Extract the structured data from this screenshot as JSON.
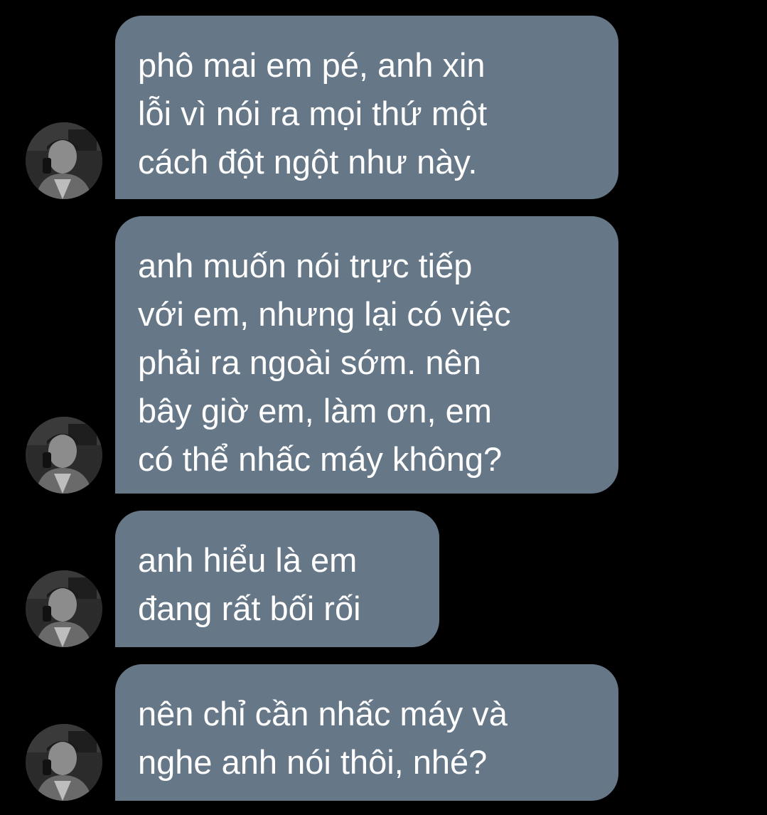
{
  "conversation": {
    "messages": [
      {
        "id": 1,
        "text": "phô mai em pé, anh xin\nlỗi vì nói ra mọi thứ một\ncách đột ngột như này."
      },
      {
        "id": 2,
        "text": "anh muốn nói trực tiếp\nvới em, nhưng lại có việc\nphải ra ngoài sớm. nên\nbây giờ em, làm ơn, em\ncó thể nhấc máy không?"
      },
      {
        "id": 3,
        "text": "anh hiểu là em\nđang rất bối rối"
      },
      {
        "id": 4,
        "text": "nên chỉ cần nhấc máy và\nnghe anh nói thôi, nhé?"
      }
    ]
  },
  "colors": {
    "background": "#000000",
    "bubble": "#667788",
    "text": "#ffffff"
  },
  "icons": {
    "avatar": "user-avatar-photo"
  }
}
